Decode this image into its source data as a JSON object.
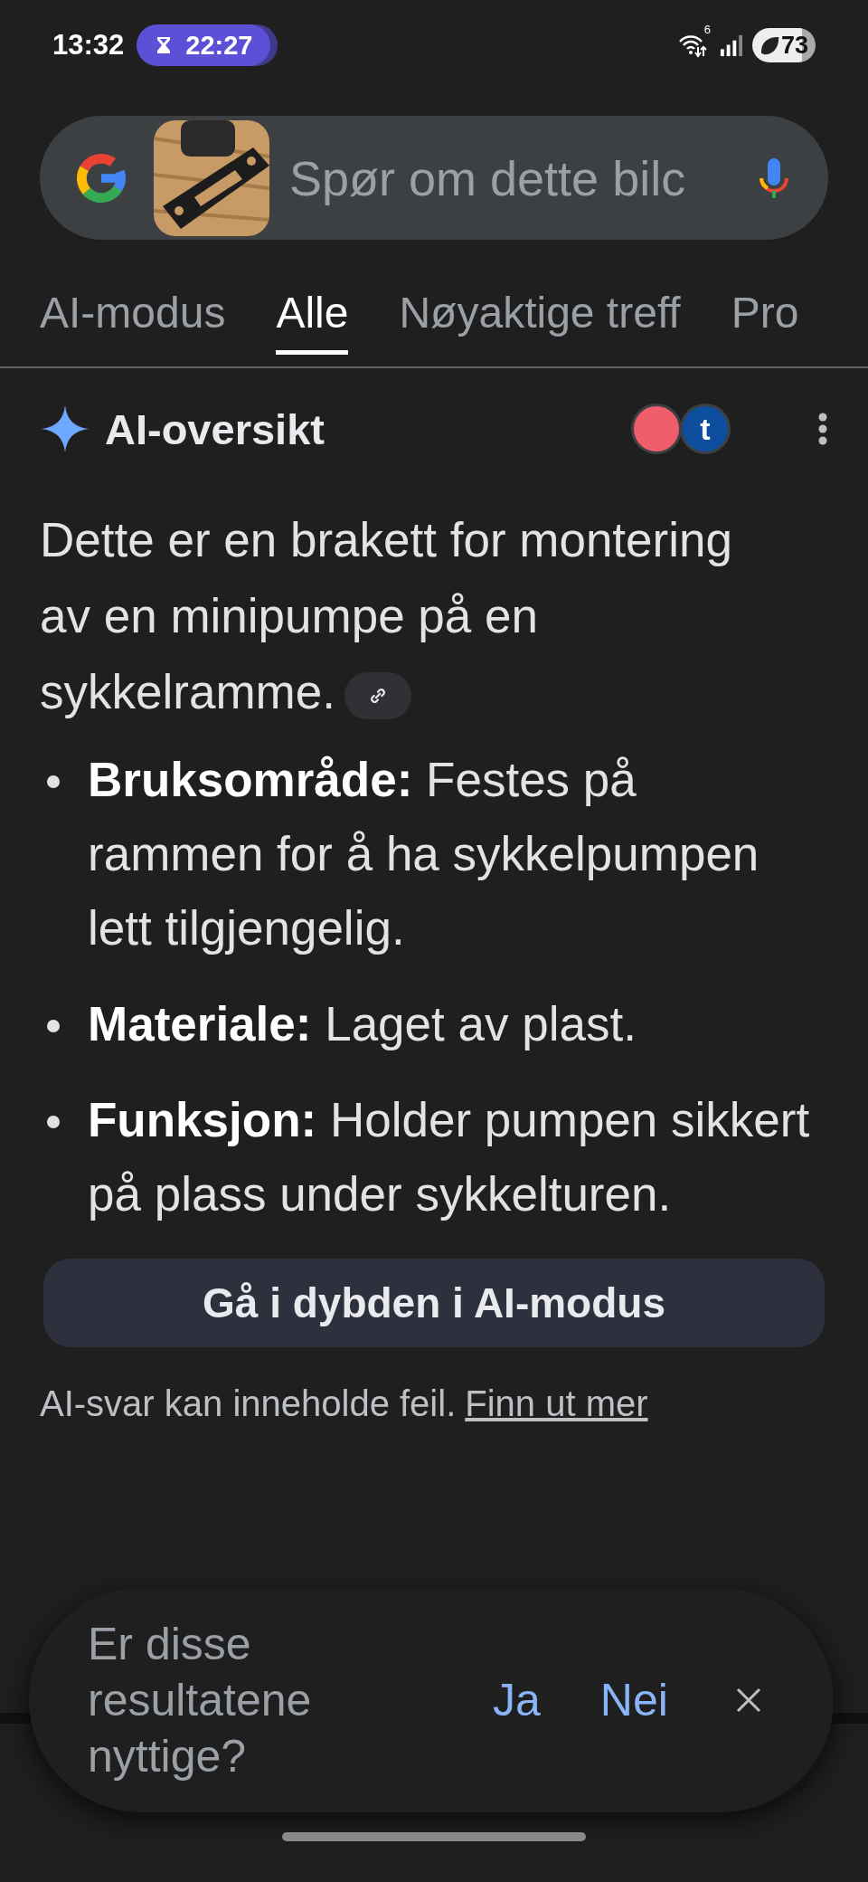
{
  "status_bar": {
    "time": "13:32",
    "timer": "22:27",
    "wifi_badge": "6",
    "battery": "73"
  },
  "search": {
    "placeholder": "Spør om dette bilc"
  },
  "tabs": [
    {
      "label": "AI-modus",
      "selected": false
    },
    {
      "label": "Alle",
      "selected": true
    },
    {
      "label": "Nøyaktige treff",
      "selected": false
    },
    {
      "label": "Pro",
      "selected": false
    }
  ],
  "ai_overview": {
    "title": "AI-oversikt",
    "sources": [
      {
        "color": "#f05d6b"
      },
      {
        "color": "#0d4f9e",
        "letter": "t"
      }
    ],
    "summary": "Dette er en brakett for montering av en minipumpe på en sykkelramme.",
    "bullets": [
      "**Bruksområde:** Festes på rammen for å ha sykkelpumpen lett tilgjengelig.",
      "**Materiale:** Laget av plast.",
      "**Funksjon:** Holder pumpen sikkert på plass under sykkelturen."
    ],
    "deep_dive_button": "Gå i dybden i AI-modus",
    "disclaimer": "AI-svar kan inneholde feil.",
    "learn_more_link": "Finn ut mer"
  },
  "feedback": {
    "question": "Er disse resultatene nyttige?",
    "yes": "Ja",
    "no": "Nei"
  }
}
